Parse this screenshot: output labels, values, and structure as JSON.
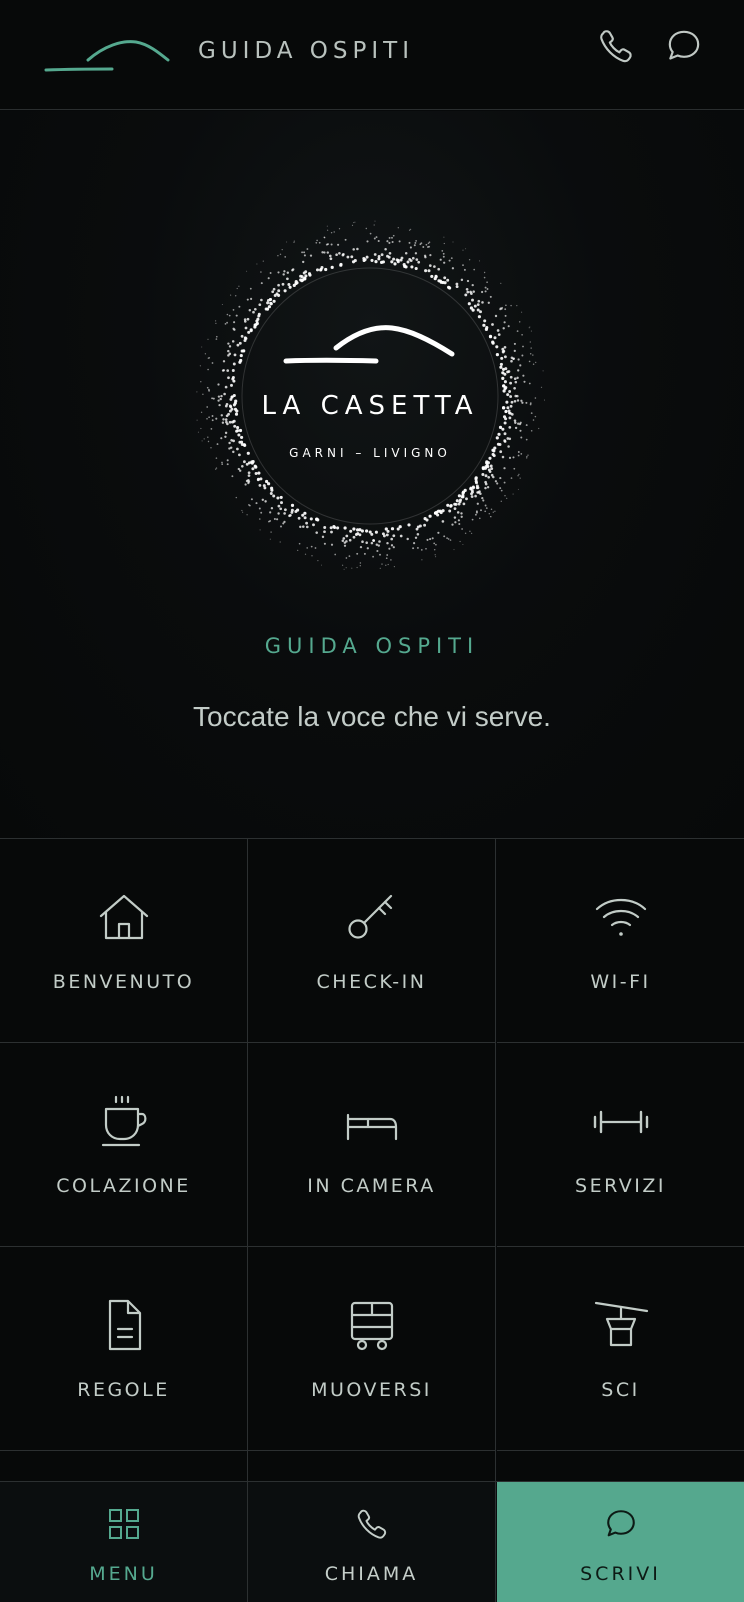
{
  "header": {
    "title": "GUIDA OSPITI",
    "logo_icon": "mountain-logo-icon",
    "phone_icon": "phone-icon",
    "chat_icon": "chat-bubble-icon"
  },
  "hero": {
    "brand_name": "LA CASETTA",
    "brand_tagline": "GARNI – LIVIGNO",
    "kicker": "GUIDA OSPITI",
    "subtitle": "Toccate la voce che vi serve."
  },
  "tiles": [
    {
      "label": "BENVENUTO",
      "icon": "house-icon"
    },
    {
      "label": "CHECK-IN",
      "icon": "key-icon"
    },
    {
      "label": "WI-FI",
      "icon": "wifi-icon"
    },
    {
      "label": "COLAZIONE",
      "icon": "coffee-cup-icon"
    },
    {
      "label": "IN CAMERA",
      "icon": "bed-icon"
    },
    {
      "label": "SERVIZI",
      "icon": "dumbbell-icon"
    },
    {
      "label": "REGOLE",
      "icon": "document-icon"
    },
    {
      "label": "MUOVERSI",
      "icon": "bus-icon"
    },
    {
      "label": "SCI",
      "icon": "ski-lift-icon"
    }
  ],
  "bottom_bar": {
    "menu_label": "MENU",
    "menu_icon": "grid-icon",
    "chiama_label": "CHIAMA",
    "chiama_icon": "phone-icon",
    "scrivi_label": "SCRIVI",
    "scrivi_icon": "chat-bubble-icon"
  },
  "colors": {
    "accent": "#55a98f",
    "background": "#070909",
    "divider": "#2c3031",
    "text": "#c2ccc7"
  }
}
